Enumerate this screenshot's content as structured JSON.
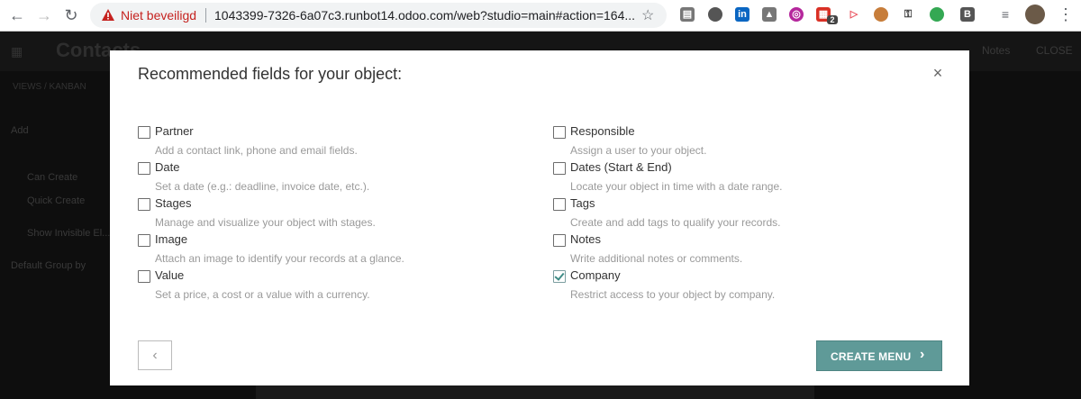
{
  "browser": {
    "security_label": "Niet beveiligd",
    "url": "1043399-7326-6a07c3.runbot14.odoo.com/web?studio=main#action=164...",
    "extensions": [
      "feed-icon",
      "evernote-icon",
      "linkedin-icon",
      "drive-icon",
      "camera-icon",
      "calendar-icon",
      "video-icon",
      "monk-icon",
      "key-icon",
      "leaf-icon",
      "b-icon"
    ],
    "ext_badge": "2"
  },
  "background": {
    "app_title": "Contacts",
    "breadcrumb": "VIEWS / KANBAN",
    "notes": "Notes",
    "close": "CLOSE",
    "side_items": [
      "Add",
      "Can Create",
      "Quick Create",
      "Show Invisible El...",
      "Default Group by"
    ]
  },
  "modal": {
    "title": "Recommended fields for your object:",
    "close_symbol": "×",
    "left_fields": [
      {
        "name": "Partner",
        "desc": "Add a contact link, phone and email fields.",
        "checked": false
      },
      {
        "name": "Date",
        "desc": "Set a date (e.g.: deadline, invoice date, etc.).",
        "checked": false
      },
      {
        "name": "Stages",
        "desc": "Manage and visualize your object with stages.",
        "checked": false
      },
      {
        "name": "Image",
        "desc": "Attach an image to identify your records at a glance.",
        "checked": false
      },
      {
        "name": "Value",
        "desc": "Set a price, a cost or a value with a currency.",
        "checked": false
      }
    ],
    "right_fields": [
      {
        "name": "Responsible",
        "desc": "Assign a user to your object.",
        "checked": false
      },
      {
        "name": "Dates (Start & End)",
        "desc": "Locate your object in time with a date range.",
        "checked": false
      },
      {
        "name": "Tags",
        "desc": "Create and add tags to qualify your records.",
        "checked": false
      },
      {
        "name": "Notes",
        "desc": "Write additional notes or comments.",
        "checked": false
      },
      {
        "name": "Company",
        "desc": "Restrict access to your object by company.",
        "checked": true
      }
    ],
    "back_symbol": "‹",
    "create_label": "CREATE MENU",
    "create_chevron": "›"
  },
  "colors": {
    "accent": "#5f9a98",
    "warning": "#c5221f"
  }
}
